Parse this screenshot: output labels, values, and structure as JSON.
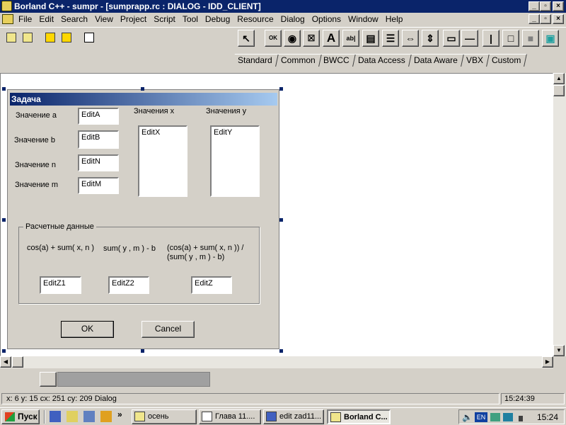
{
  "window": {
    "title": "Borland C++ - sumpr - [sumprapp.rc : DIALOG - IDD_CLIENT]"
  },
  "menu": [
    "File",
    "Edit",
    "Search",
    "View",
    "Project",
    "Script",
    "Tool",
    "Debug",
    "Resource",
    "Dialog",
    "Options",
    "Window",
    "Help"
  ],
  "palette_tabs": [
    "Standard",
    "Common",
    "BWCC",
    "Data Access",
    "Data Aware",
    "VBX",
    "Custom"
  ],
  "palette_tools": {
    "ok": "OK",
    "ab": "ab|",
    "text": "A"
  },
  "dialog": {
    "title": "Задача",
    "label_a": "Значение a",
    "label_b": "Значение b",
    "label_n": "Значение n",
    "label_m": "Значение m",
    "edit_a": "EditA",
    "edit_b": "EditB",
    "edit_n": "EditN",
    "edit_m": "EditM",
    "label_x": "Значения x",
    "label_y": "Значения y",
    "edit_x": "EditX",
    "edit_y": "EditY",
    "group_title": "Расчетные данные",
    "formula1": "cos(a) + sum( x, n )",
    "formula2": "sum( y , m ) - b",
    "formula3_line1": "(cos(a) + sum( x, n )) /",
    "formula3_line2": "(sum( y , m ) - b)",
    "edit_z1": "EditZ1",
    "edit_z2": "EditZ2",
    "edit_z": "EditZ",
    "ok": "OK",
    "cancel": "Cancel"
  },
  "status": {
    "coords": "x: 6  y: 15  cx: 251  cy: 209   Dialog",
    "time": "15:24:39"
  },
  "taskbar": {
    "start": "Пуск",
    "tasks": [
      "осень",
      "Глава 11....",
      "edit zad11...",
      "Borland C..."
    ],
    "lang": "EN",
    "clock": "15:24"
  },
  "colors": {
    "titlebar": "#0a246a",
    "face": "#d4d0c8",
    "workspace": "#ffffff"
  }
}
